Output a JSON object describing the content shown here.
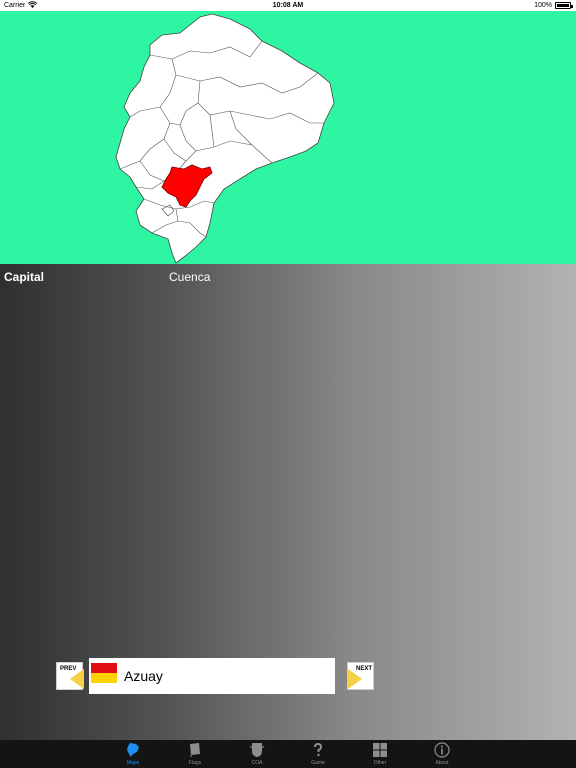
{
  "status_bar": {
    "carrier": "Carrier",
    "time": "10:08 AM",
    "battery": "100%"
  },
  "map": {
    "highlighted_province": "Azuay",
    "highlight_color": "#ff0000",
    "background_color": "#2ef5a2",
    "land_color": "#ffffff"
  },
  "info": {
    "capital_label": "Capital",
    "capital_value": "Cuenca"
  },
  "navigation": {
    "prev_label": "PREV",
    "next_label": "NEXT",
    "province_name": "Azuay",
    "flag_colors": [
      "#e20e16",
      "#ffd400"
    ]
  },
  "tabs": [
    {
      "label": "Maps",
      "icon": "map-icon",
      "active": true
    },
    {
      "label": "Flags",
      "icon": "flag-icon",
      "active": false
    },
    {
      "label": "COA",
      "icon": "coat-of-arms-icon",
      "active": false
    },
    {
      "label": "Game",
      "icon": "question-icon",
      "active": false
    },
    {
      "label": "Other",
      "icon": "grid-icon",
      "active": false
    },
    {
      "label": "About",
      "icon": "info-icon",
      "active": false
    }
  ],
  "colors": {
    "tab_active": "#1e8ff2",
    "tab_inactive": "#8e8e8e",
    "tab_bar_bg": "#141414"
  }
}
